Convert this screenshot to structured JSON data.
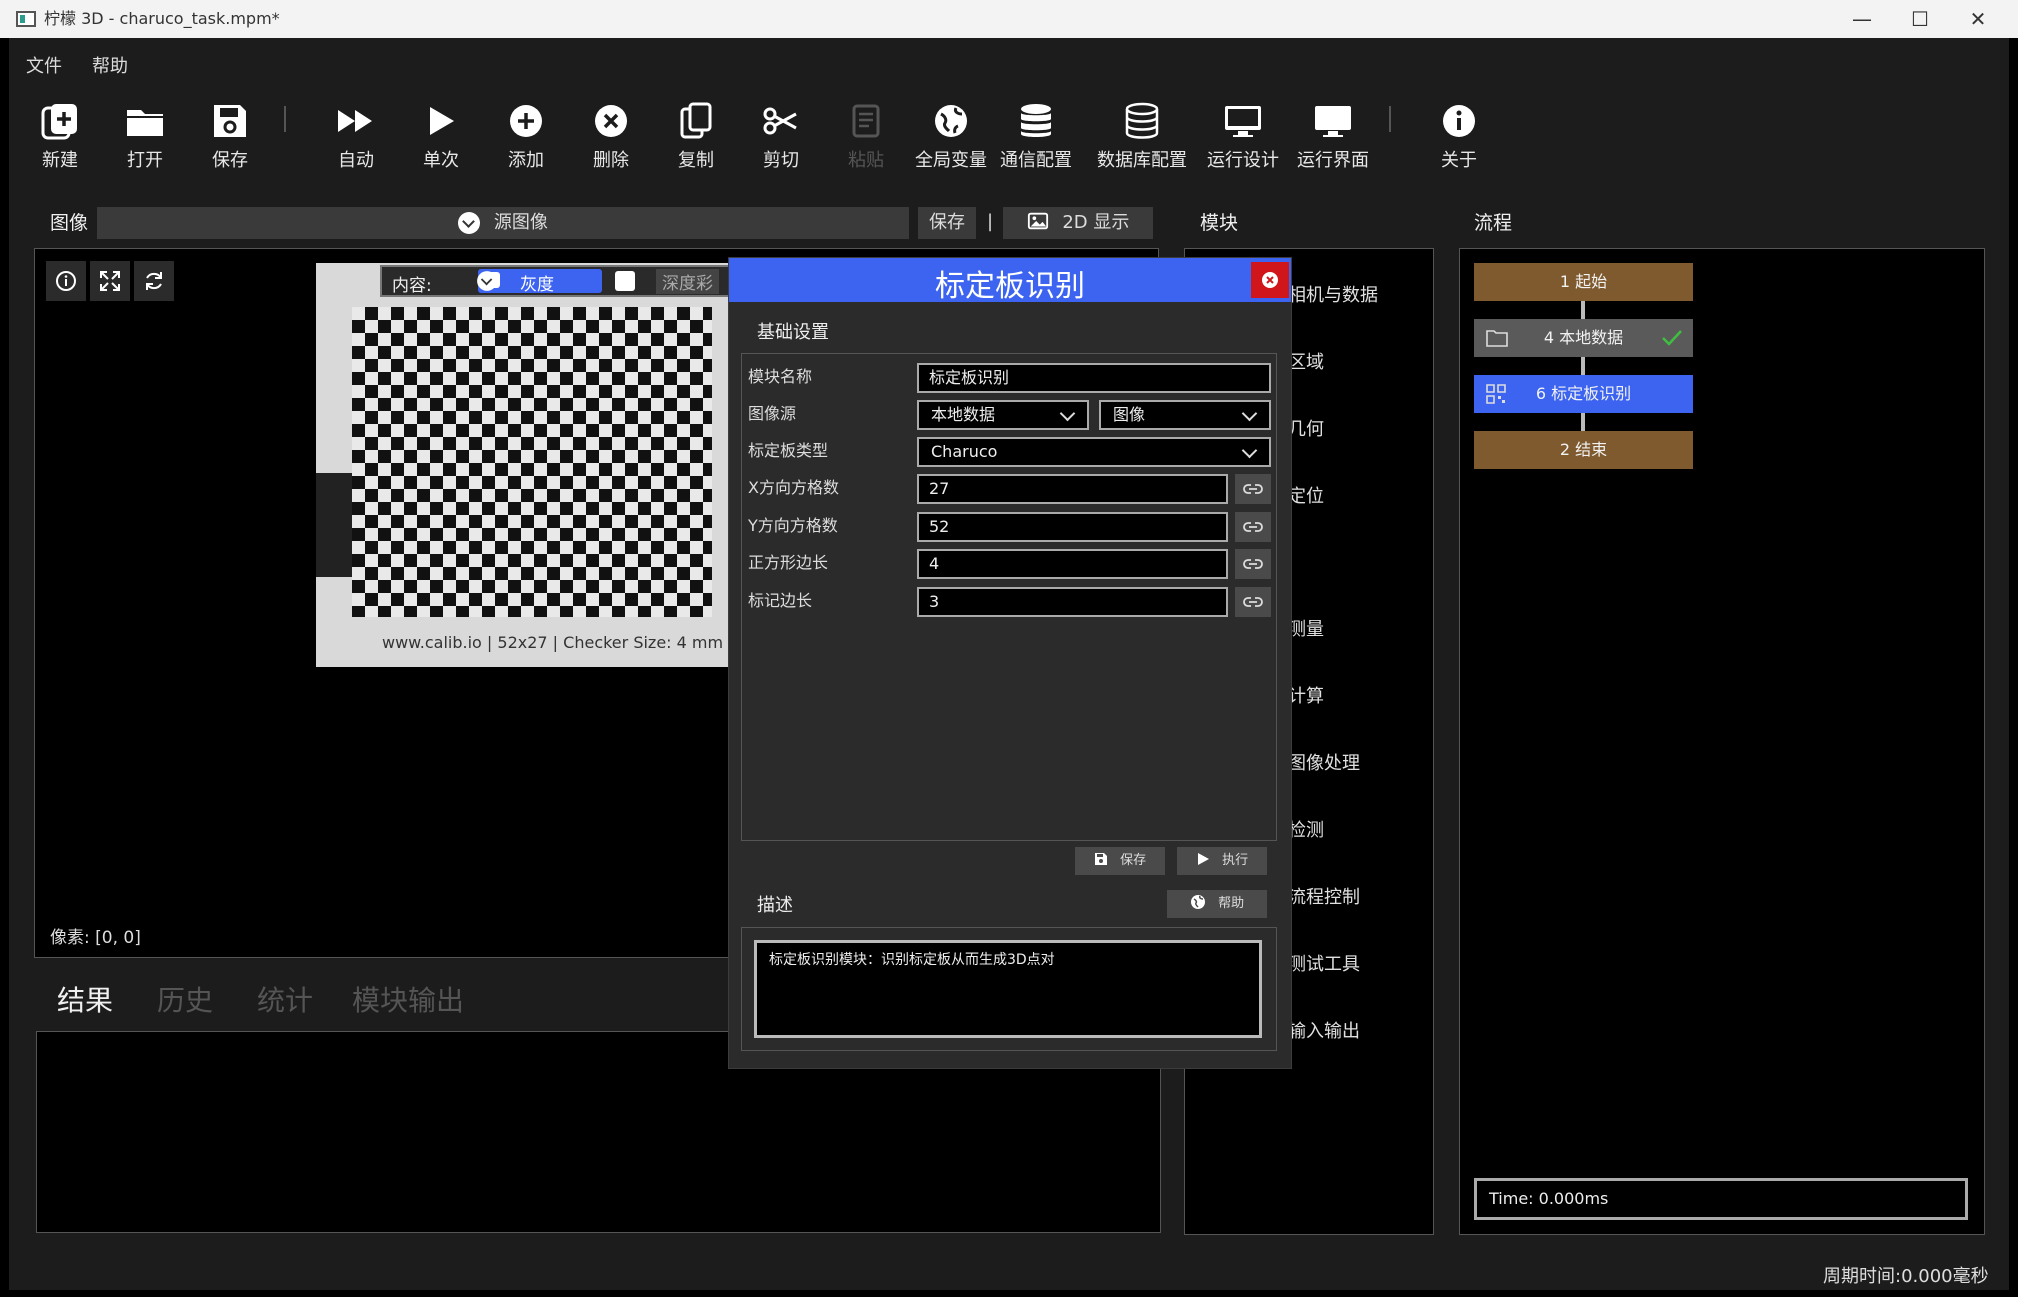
{
  "window": {
    "title": "柠檬 3D  - charuco_task.mpm*",
    "minimize": "—",
    "maximize": "☐",
    "close": "✕"
  },
  "menu": {
    "file": "文件",
    "help": "帮助"
  },
  "toolbar": [
    {
      "label": "新建",
      "icon": "new-file-icon",
      "disabled": false
    },
    {
      "label": "打开",
      "icon": "folder-icon",
      "disabled": false
    },
    {
      "label": "保存",
      "icon": "save-icon",
      "disabled": false
    },
    {
      "label": "自动",
      "icon": "fast-forward-icon",
      "disabled": false
    },
    {
      "label": "单次",
      "icon": "play-icon",
      "disabled": false
    },
    {
      "label": "添加",
      "icon": "add-circle-icon",
      "disabled": false
    },
    {
      "label": "删除",
      "icon": "delete-circle-icon",
      "disabled": false
    },
    {
      "label": "复制",
      "icon": "copy-icon",
      "disabled": false
    },
    {
      "label": "剪切",
      "icon": "scissors-icon",
      "disabled": false
    },
    {
      "label": "粘贴",
      "icon": "paste-icon",
      "disabled": true
    },
    {
      "label": "全局变量",
      "icon": "globe-icon",
      "disabled": false
    },
    {
      "label": "通信配置",
      "icon": "database-icon",
      "disabled": false
    },
    {
      "label": "数据库配置",
      "icon": "database-outline-icon",
      "disabled": false
    },
    {
      "label": "运行设计",
      "icon": "monitor-icon",
      "disabled": false
    },
    {
      "label": "运行界面",
      "icon": "monitor-filled-icon",
      "disabled": false
    },
    {
      "label": "关于",
      "icon": "info-icon",
      "disabled": false
    }
  ],
  "image_panel": {
    "title": "图像",
    "source_dropdown": "源图像",
    "save_button": "保存",
    "separator": "|",
    "display_button": "2D 显示",
    "content_label": "内容:",
    "content_mode": "灰度",
    "depth_label": "深度彩",
    "pixel_readout": "像素: [0, 0]",
    "board_caption": "www.calib.io | 52x27 | Checker Size: 4 mm"
  },
  "result_tabs": [
    "结果",
    "历史",
    "统计",
    "模块输出"
  ],
  "module_panel": {
    "title": "模块",
    "items": [
      "相机与数据",
      "区域",
      "几何",
      "定位",
      "测量",
      "计算",
      "图像处理",
      "检测",
      "流程控制",
      "测试工具",
      "输入输出"
    ]
  },
  "flow_panel": {
    "title": "流程",
    "nodes": [
      {
        "label": "1 起始",
        "color": "#7f5a2e"
      },
      {
        "label": "4 本地数据",
        "color": "#5a5a5a"
      },
      {
        "label": "6 标定板识别",
        "color": "#3c64f0"
      },
      {
        "label": "2 结束",
        "color": "#7f5a2e"
      }
    ],
    "time": "Time: 0.000ms"
  },
  "dialog": {
    "title": "标定板识别",
    "basic_section": "基础设置",
    "fields": {
      "module_name_label": "模块名称",
      "module_name": "标定板识别",
      "image_source_label": "图像源",
      "image_source": "本地数据",
      "image_source_sub": "图像",
      "board_type_label": "标定板类型",
      "board_type": "Charuco",
      "x_count_label": "X方向方格数",
      "x_count": "27",
      "y_count_label": "Y方向方格数",
      "y_count": "52",
      "square_len_label": "正方形边长",
      "square_len": "4",
      "marker_len_label": "标记边长",
      "marker_len": "3"
    },
    "save_button": "保存",
    "run_button": "执行",
    "desc_section": "描述",
    "help_button": "帮助",
    "description": "标定板识别模块：识别标定板从而生成3D点对"
  },
  "status_bar": {
    "cycle_time": "周期时间:0.000毫秒"
  },
  "colors": {
    "accent": "#3c64f0",
    "close_red": "#d0161b",
    "flow_brown": "#7f5a2e",
    "check_green": "#3fbf3f"
  }
}
